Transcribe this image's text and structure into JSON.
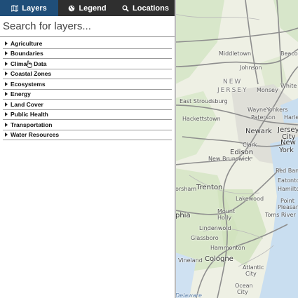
{
  "tabs": [
    {
      "label": "Layers",
      "icon": "map-icon",
      "active": true
    },
    {
      "label": "Legend",
      "icon": "globe-icon",
      "active": false
    },
    {
      "label": "Locations",
      "icon": "search-icon",
      "active": false
    }
  ],
  "search": {
    "placeholder": "Search for layers..."
  },
  "layers": [
    {
      "label": "Agriculture"
    },
    {
      "label": "Boundaries"
    },
    {
      "label": "Climate Data"
    },
    {
      "label": "Coastal Zones"
    },
    {
      "label": "Ecosystems"
    },
    {
      "label": "Energy"
    },
    {
      "label": "Land Cover"
    },
    {
      "label": "Public Health"
    },
    {
      "label": "Transportation"
    },
    {
      "label": "Water Resources"
    }
  ],
  "map": {
    "labels": {
      "middletown": "Middletown",
      "beacon": "Beacon",
      "johnson": "Johnson",
      "new": "NEW",
      "jersey": "JERSEY",
      "monsey": "Monsey",
      "white_plains": "White",
      "east_stroudsburg": "East Stroudsburg",
      "wayne": "Wayne",
      "yonkers": "Yonkers",
      "paterson": "Paterson",
      "harlem": "Harlem",
      "hackettstown": "Hackettstown",
      "newark": "Newark",
      "jersey_city": "Jersey",
      "city": "City",
      "clark": "Clark",
      "new_york": "New",
      "york": "York",
      "edison": "Edison",
      "new_brunswick": "New Brunswick",
      "red_bank": "Red Bank",
      "eatontown": "Eatontown",
      "trenton": "Trenton",
      "horsham": "orsham",
      "hamilton": "Hamilton",
      "lakewood": "Lakewood",
      "point": "Point",
      "pleasant": "Pleasant",
      "toms_river": "Toms River",
      "phia": "phia",
      "mount": "Mount",
      "holly": "Holly",
      "lindenwold": "Lindenwold",
      "glassboro": "Glassboro",
      "hammonton": "Hammonton",
      "vineland": "Vineland",
      "cologne": "Cologne",
      "atlantic": "Atlantic",
      "city2": "City",
      "ocean": "Ocean",
      "city3": "City",
      "delaware": "Delaware"
    }
  }
}
